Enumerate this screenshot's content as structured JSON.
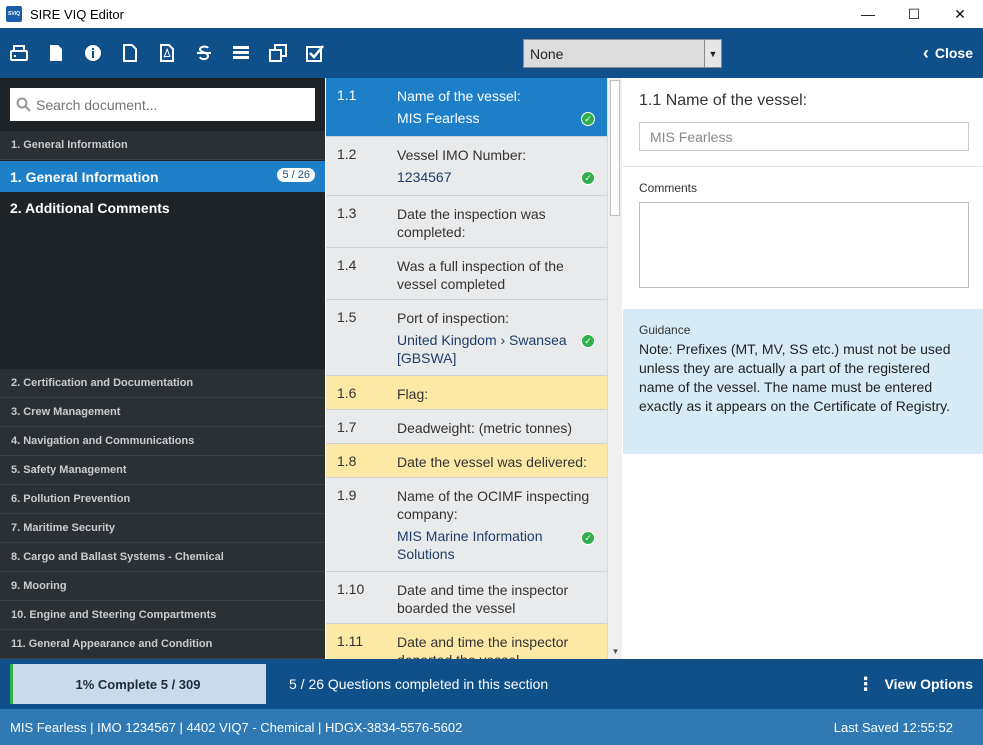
{
  "window": {
    "logo_text": "SVIQ",
    "title": "SIRE VIQ Editor",
    "minimize": "—",
    "maximize": "☐",
    "close": "✕"
  },
  "toolbar": {
    "filter_value": "None",
    "close_label": "Close",
    "icons": [
      "save-icon",
      "new-document-icon",
      "info-icon",
      "blank-page-icon",
      "pdf-icon",
      "strikethrough-icon",
      "list-icon",
      "copy-icon",
      "checkbox-icon"
    ]
  },
  "sidebar": {
    "search_placeholder": "Search document...",
    "header_top": "1. General Information",
    "items": [
      {
        "label": "1.  General Information",
        "badge": "5 / 26"
      },
      {
        "label": "2.  Additional Comments"
      }
    ],
    "sections": [
      "2. Certification and Documentation",
      "3. Crew Management",
      "4. Navigation and Communications",
      "5. Safety Management",
      "6. Pollution Prevention",
      "7. Maritime Security",
      "8. Cargo and Ballast Systems - Chemical",
      "9. Mooring",
      "10. Engine and Steering Compartments",
      "11. General Appearance and Condition"
    ]
  },
  "questions": [
    {
      "num": "1.1",
      "text": "Name of the vessel:",
      "answer": "MIS Fearless"
    },
    {
      "num": "1.2",
      "text": "Vessel IMO Number:",
      "answer": "1234567"
    },
    {
      "num": "1.3",
      "text": "Date the inspection was completed:"
    },
    {
      "num": "1.4",
      "text": "Was a full inspection of the vessel completed"
    },
    {
      "num": "1.5",
      "text": "Port of inspection:",
      "answer": "United Kingdom › Swansea [GBSWA]"
    },
    {
      "num": "1.6",
      "text": "Flag:"
    },
    {
      "num": "1.7",
      "text": "Deadweight: (metric tonnes)"
    },
    {
      "num": "1.8",
      "text": "Date the vessel was delivered:"
    },
    {
      "num": "1.9",
      "text": "Name of the OCIMF inspecting company:",
      "answer": "MIS Marine Information Solutions"
    },
    {
      "num": "1.10",
      "text": "Date and time the inspector boarded the vessel"
    },
    {
      "num": "1.11",
      "text": "Date and time the inspector departed the vessel"
    }
  ],
  "detail": {
    "title": "1.1 Name of the vessel:",
    "answer_value": "MIS Fearless",
    "comments_label": "Comments",
    "guidance_label": "Guidance",
    "guidance_text": "Note:  Prefixes (MT, MV, SS etc.) must not be used unless they are actually a part of the registered name of the vessel.  The name must be entered exactly as it appears on the Certificate of Registry."
  },
  "bottom": {
    "progress_percent": 1,
    "progress_label": "1% Complete 5 / 309",
    "section_status": "5 / 26 Questions completed in this section",
    "view_options": "View Options"
  },
  "status": {
    "info": "MIS Fearless  |  IMO 1234567  |  4402 VIQ7 - Chemical  |  HDGX-3834-5576-5602",
    "last_saved": "Last Saved 12:55:52"
  },
  "colors": {
    "primary": "#0f4f8a",
    "accent": "#1e7fc9",
    "flag": "#fde9a6",
    "complete": "#2fb04c"
  }
}
